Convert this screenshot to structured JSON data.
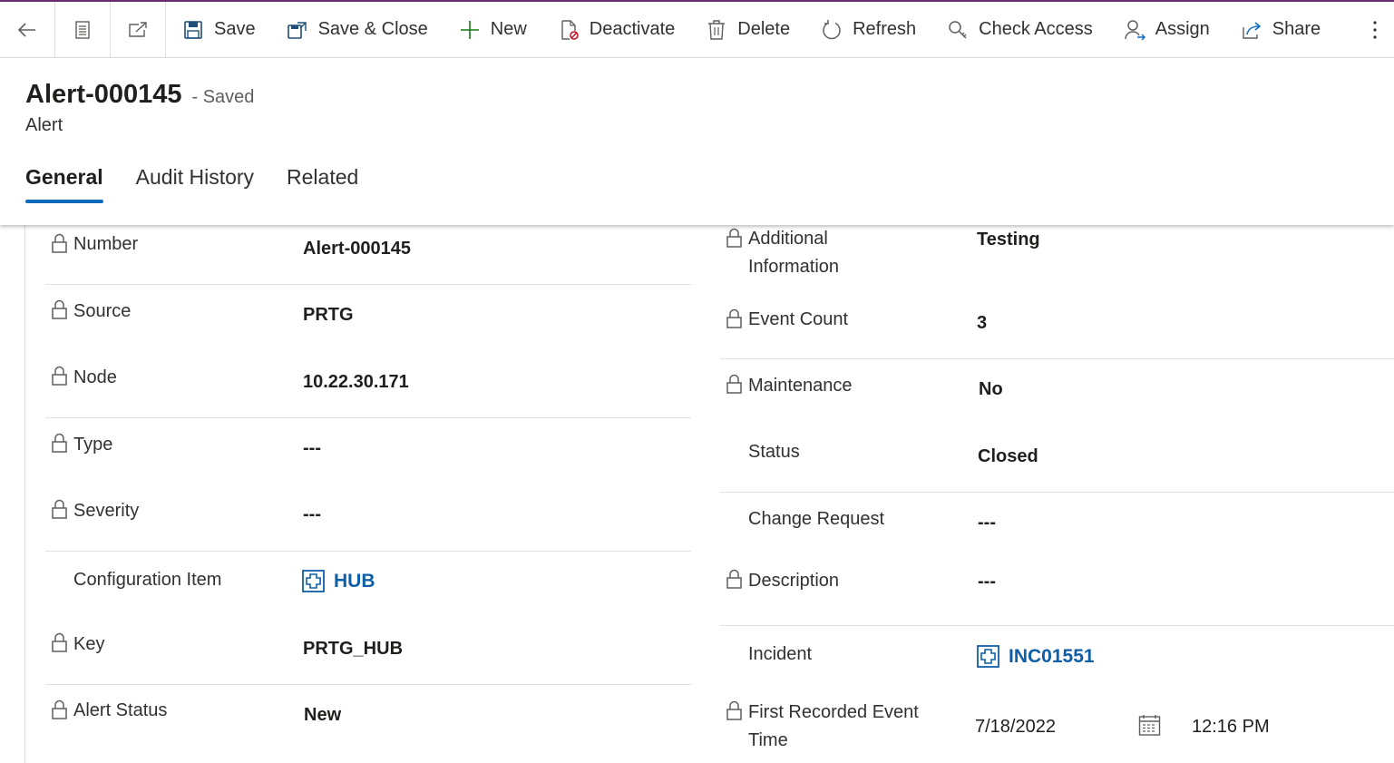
{
  "toolbar": {
    "save": "Save",
    "save_close": "Save & Close",
    "new": "New",
    "deactivate": "Deactivate",
    "delete": "Delete",
    "refresh": "Refresh",
    "check_access": "Check Access",
    "assign": "Assign",
    "share": "Share"
  },
  "header": {
    "title": "Alert-000145",
    "saved_status": "- Saved",
    "entity": "Alert"
  },
  "tabs": [
    "General",
    "Audit History",
    "Related"
  ],
  "fields_left": {
    "number": {
      "label": "Number",
      "value": "Alert-000145"
    },
    "source": {
      "label": "Source",
      "value": "PRTG"
    },
    "node": {
      "label": "Node",
      "value": "10.22.30.171"
    },
    "type": {
      "label": "Type",
      "value": "---"
    },
    "severity": {
      "label": "Severity",
      "value": "---"
    },
    "configuration_item": {
      "label": "Configuration Item",
      "value": "HUB"
    },
    "key": {
      "label": "Key",
      "value": "PRTG_HUB"
    },
    "alert_status": {
      "label": "Alert Status",
      "value": "New"
    }
  },
  "fields_right": {
    "additional_information": {
      "label_line1": "Additional",
      "label_line2": "Information",
      "value": "Testing"
    },
    "event_count": {
      "label": "Event Count",
      "value": "3"
    },
    "maintenance": {
      "label": "Maintenance",
      "value": "No"
    },
    "status": {
      "label": "Status",
      "value": "Closed"
    },
    "change_request": {
      "label": "Change Request",
      "value": "---"
    },
    "description": {
      "label": "Description",
      "value": "---"
    },
    "incident": {
      "label": "Incident",
      "value": "INC01551"
    },
    "first_recorded_event_time": {
      "label_line1": "First Recorded Event",
      "label_line2": "Time",
      "date": "7/18/2022",
      "time": "12:16 PM"
    }
  },
  "colors": {
    "accent": "#0f6cbd",
    "link": "#0f5fa8",
    "top_bar": "#6b2c6f",
    "new_icon": "#107c10"
  }
}
